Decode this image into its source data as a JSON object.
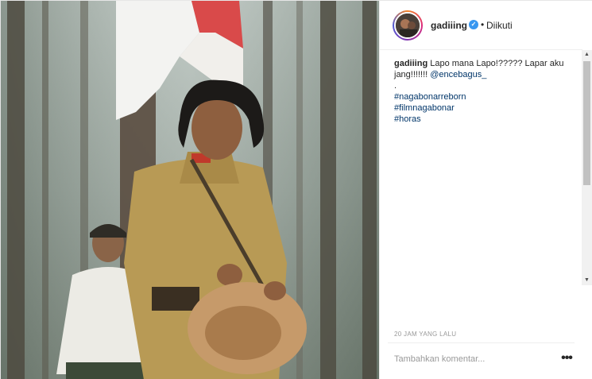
{
  "post": {
    "author": {
      "username": "gadiiing",
      "verified_icon": "verified-badge-icon",
      "separator": "•",
      "follow_state": "Diikuti"
    },
    "caption": {
      "username": "gadiiing",
      "text_line1": "Lapo mana Lapo!????? Lapar aku",
      "text_line2_prefix": "jang!!!!!!! ",
      "mention": "@encebagus_",
      "dot_line": ".",
      "hashtags": [
        "#nagabonarreborn",
        "#filmnagabonar",
        "#horas"
      ]
    },
    "timestamp": "20 JAM YANG LALU",
    "comment": {
      "placeholder": "Tambahkan komentar...",
      "more_icon": "more-options-icon",
      "more_label": "•••"
    }
  },
  "colors": {
    "link": "#003569",
    "verified": "#3897f0",
    "muted": "#999999",
    "text": "#262626"
  }
}
